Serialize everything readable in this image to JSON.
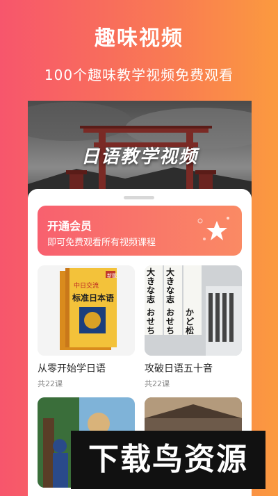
{
  "header": {
    "title": "趣味视频",
    "subtitle": "100个趣味教学视频免费观看"
  },
  "hero": {
    "text": "日语教学视频"
  },
  "vip": {
    "title": "开通会员",
    "description": "即可免费观看所有视频课程",
    "icon": "star-icon"
  },
  "courses": [
    {
      "title": "从零开始学日语",
      "count": "共22课",
      "thumb": "book-cover"
    },
    {
      "title": "攻破日语五十音",
      "count": "共22课",
      "thumb": "calligraphy"
    },
    {
      "title": "",
      "count": "",
      "thumb": "anime-scene"
    },
    {
      "title": "",
      "count": "",
      "thumb": "anime-scene"
    }
  ],
  "book": {
    "badge": "新版",
    "publisher": "中日交流",
    "title": "标准日本语"
  },
  "calligraphy": {
    "texts": [
      "大きな志",
      "大きな志",
      "おせち",
      "おせち",
      "かど松"
    ]
  },
  "watermark": "下载鸟资源"
}
